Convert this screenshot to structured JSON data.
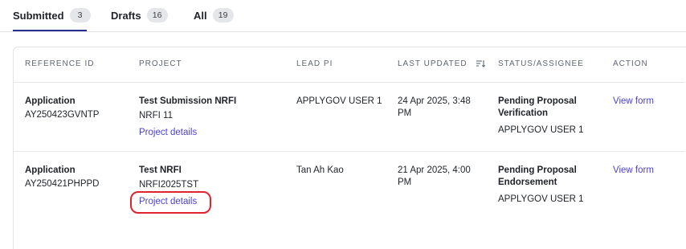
{
  "tabs": [
    {
      "label": "Submitted",
      "count": "3"
    },
    {
      "label": "Drafts",
      "count": "16"
    },
    {
      "label": "All",
      "count": "19"
    }
  ],
  "table": {
    "headers": [
      "REFERENCE ID",
      "PROJECT",
      "LEAD PI",
      "LAST UPDATED",
      "STATUS/ASSIGNEE",
      "ACTION"
    ],
    "rows": [
      {
        "ref_type": "Application",
        "ref_id": "AY250423GVNTP",
        "project_title": "Test Submission NRFI",
        "project_code": "NRFI 11",
        "project_link": "Project details",
        "lead_pi": "APPLYGOV USER 1",
        "updated_line1": "24 Apr 2025, 3:48",
        "updated_line2": "PM",
        "status_line1": "Pending Proposal",
        "status_line2": "Verification",
        "assignee": "APPLYGOV USER 1",
        "action": "View form"
      },
      {
        "ref_type": "Application",
        "ref_id": "AY250421PHPPD",
        "project_title": "Test NRFI",
        "project_code": "NRFI2025TST",
        "project_link": "Project details",
        "lead_pi": "Tan Ah Kao",
        "updated_line1": "21 Apr 2025, 4:00",
        "updated_line2": "PM",
        "status_line1": "Pending Proposal",
        "status_line2": "Endorsement",
        "assignee": "APPLYGOV USER 1",
        "action": "View form"
      }
    ]
  },
  "icons": {
    "sort": "sort-icon"
  },
  "colors": {
    "link": "#4b3fd6",
    "tab_underline": "#2a2f8f",
    "highlight": "#e0242c"
  }
}
